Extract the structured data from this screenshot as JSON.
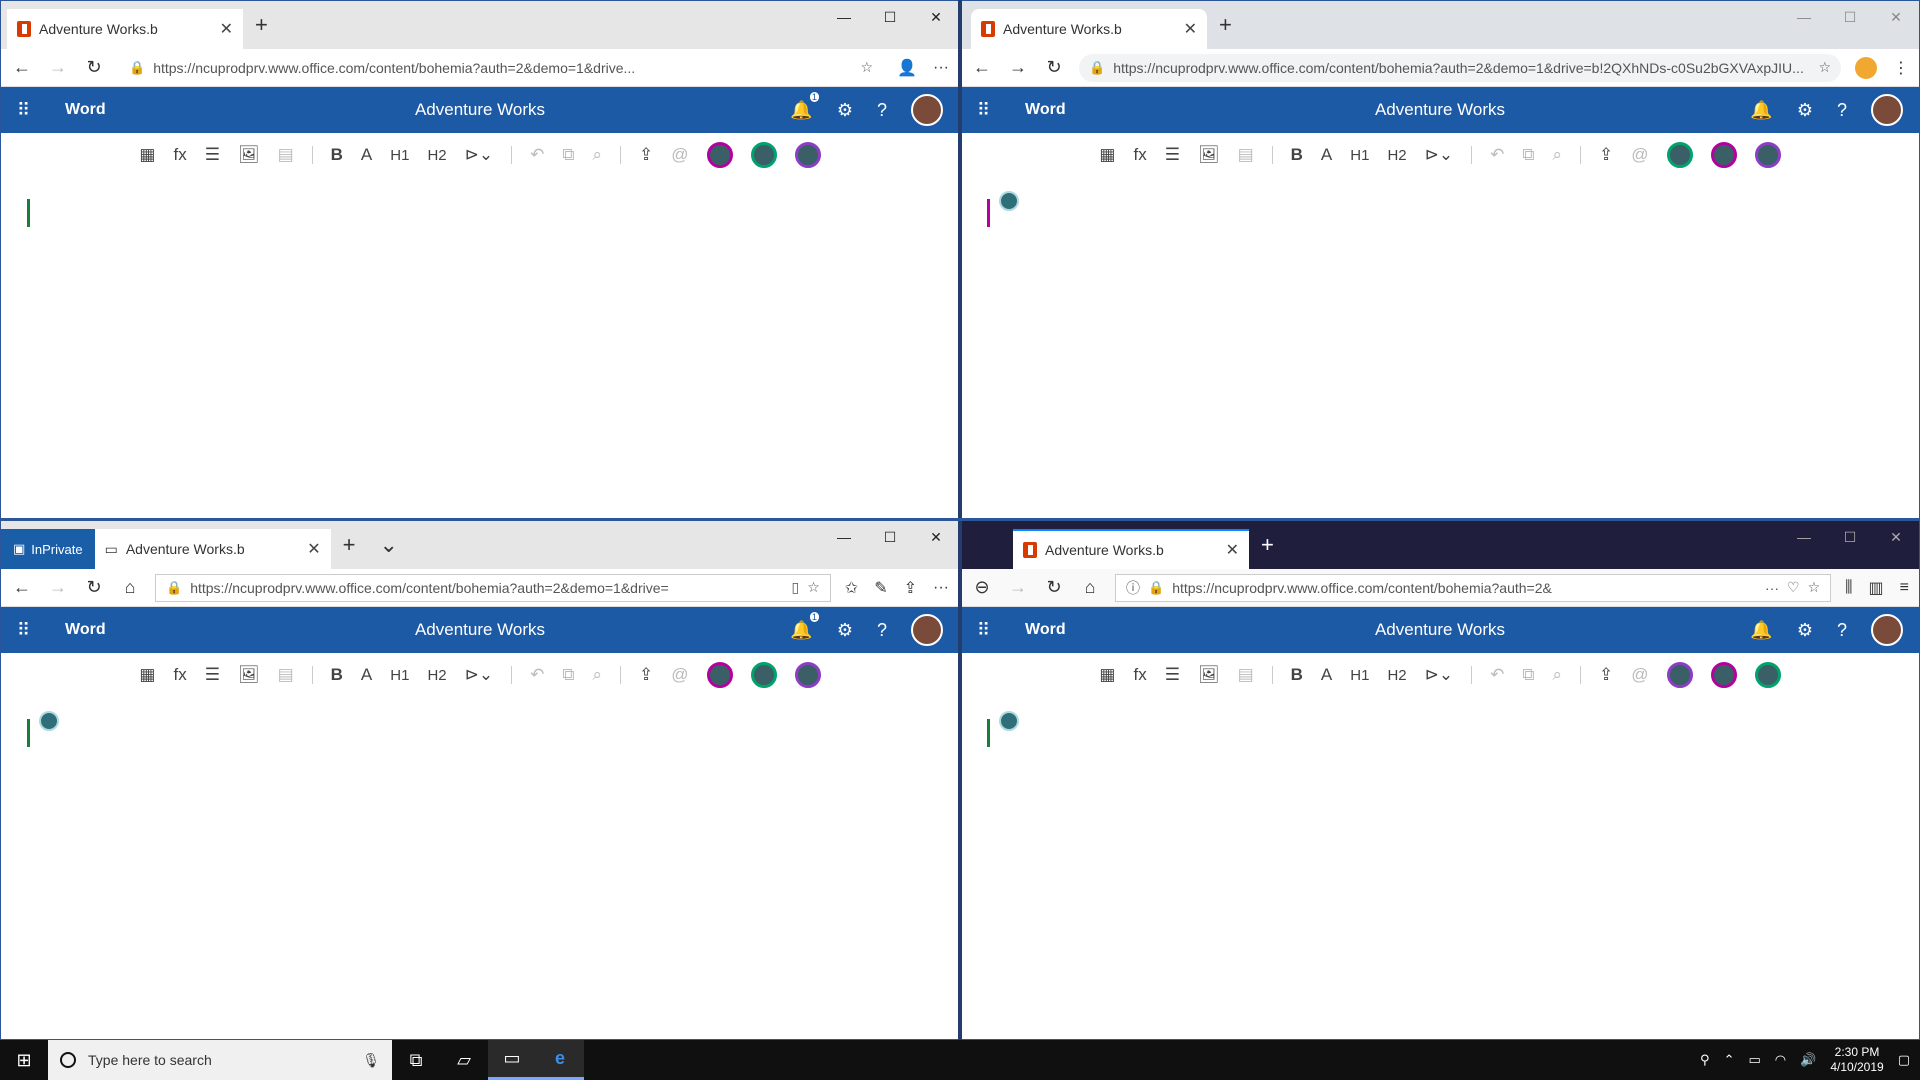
{
  "tab_title": "Adventure Works.b",
  "inprivate_label": "InPrivate",
  "urls": {
    "w0": "https://ncuprodprv.www.office.com/content/bohemia?auth=2&demo=1&drive...",
    "w1": "https://ncuprodprv.www.office.com/content/bohemia?auth=2&demo=1&drive=b!2QXhNDs-c0Su2bGXVAxpJIU...",
    "w2": "https://ncuprodprv.www.office.com/content/bohemia?auth=2&demo=1&drive=",
    "w3": "https://ncuprodprv.www.office.com/content/bohemia?auth=2&"
  },
  "app": {
    "name": "Word",
    "doc_title": "Adventure Works",
    "notification_count": "1"
  },
  "toolbar": {
    "h1": "H1",
    "h2": "H2",
    "bold": "B",
    "font": "A",
    "fx": "fx"
  },
  "taskbar": {
    "search_placeholder": "Type here to search",
    "time": "2:30 PM",
    "date": "4/10/2019"
  },
  "colors": {
    "word_blue": "#1c5aa6",
    "ff_dark": "#1f1f3d"
  }
}
